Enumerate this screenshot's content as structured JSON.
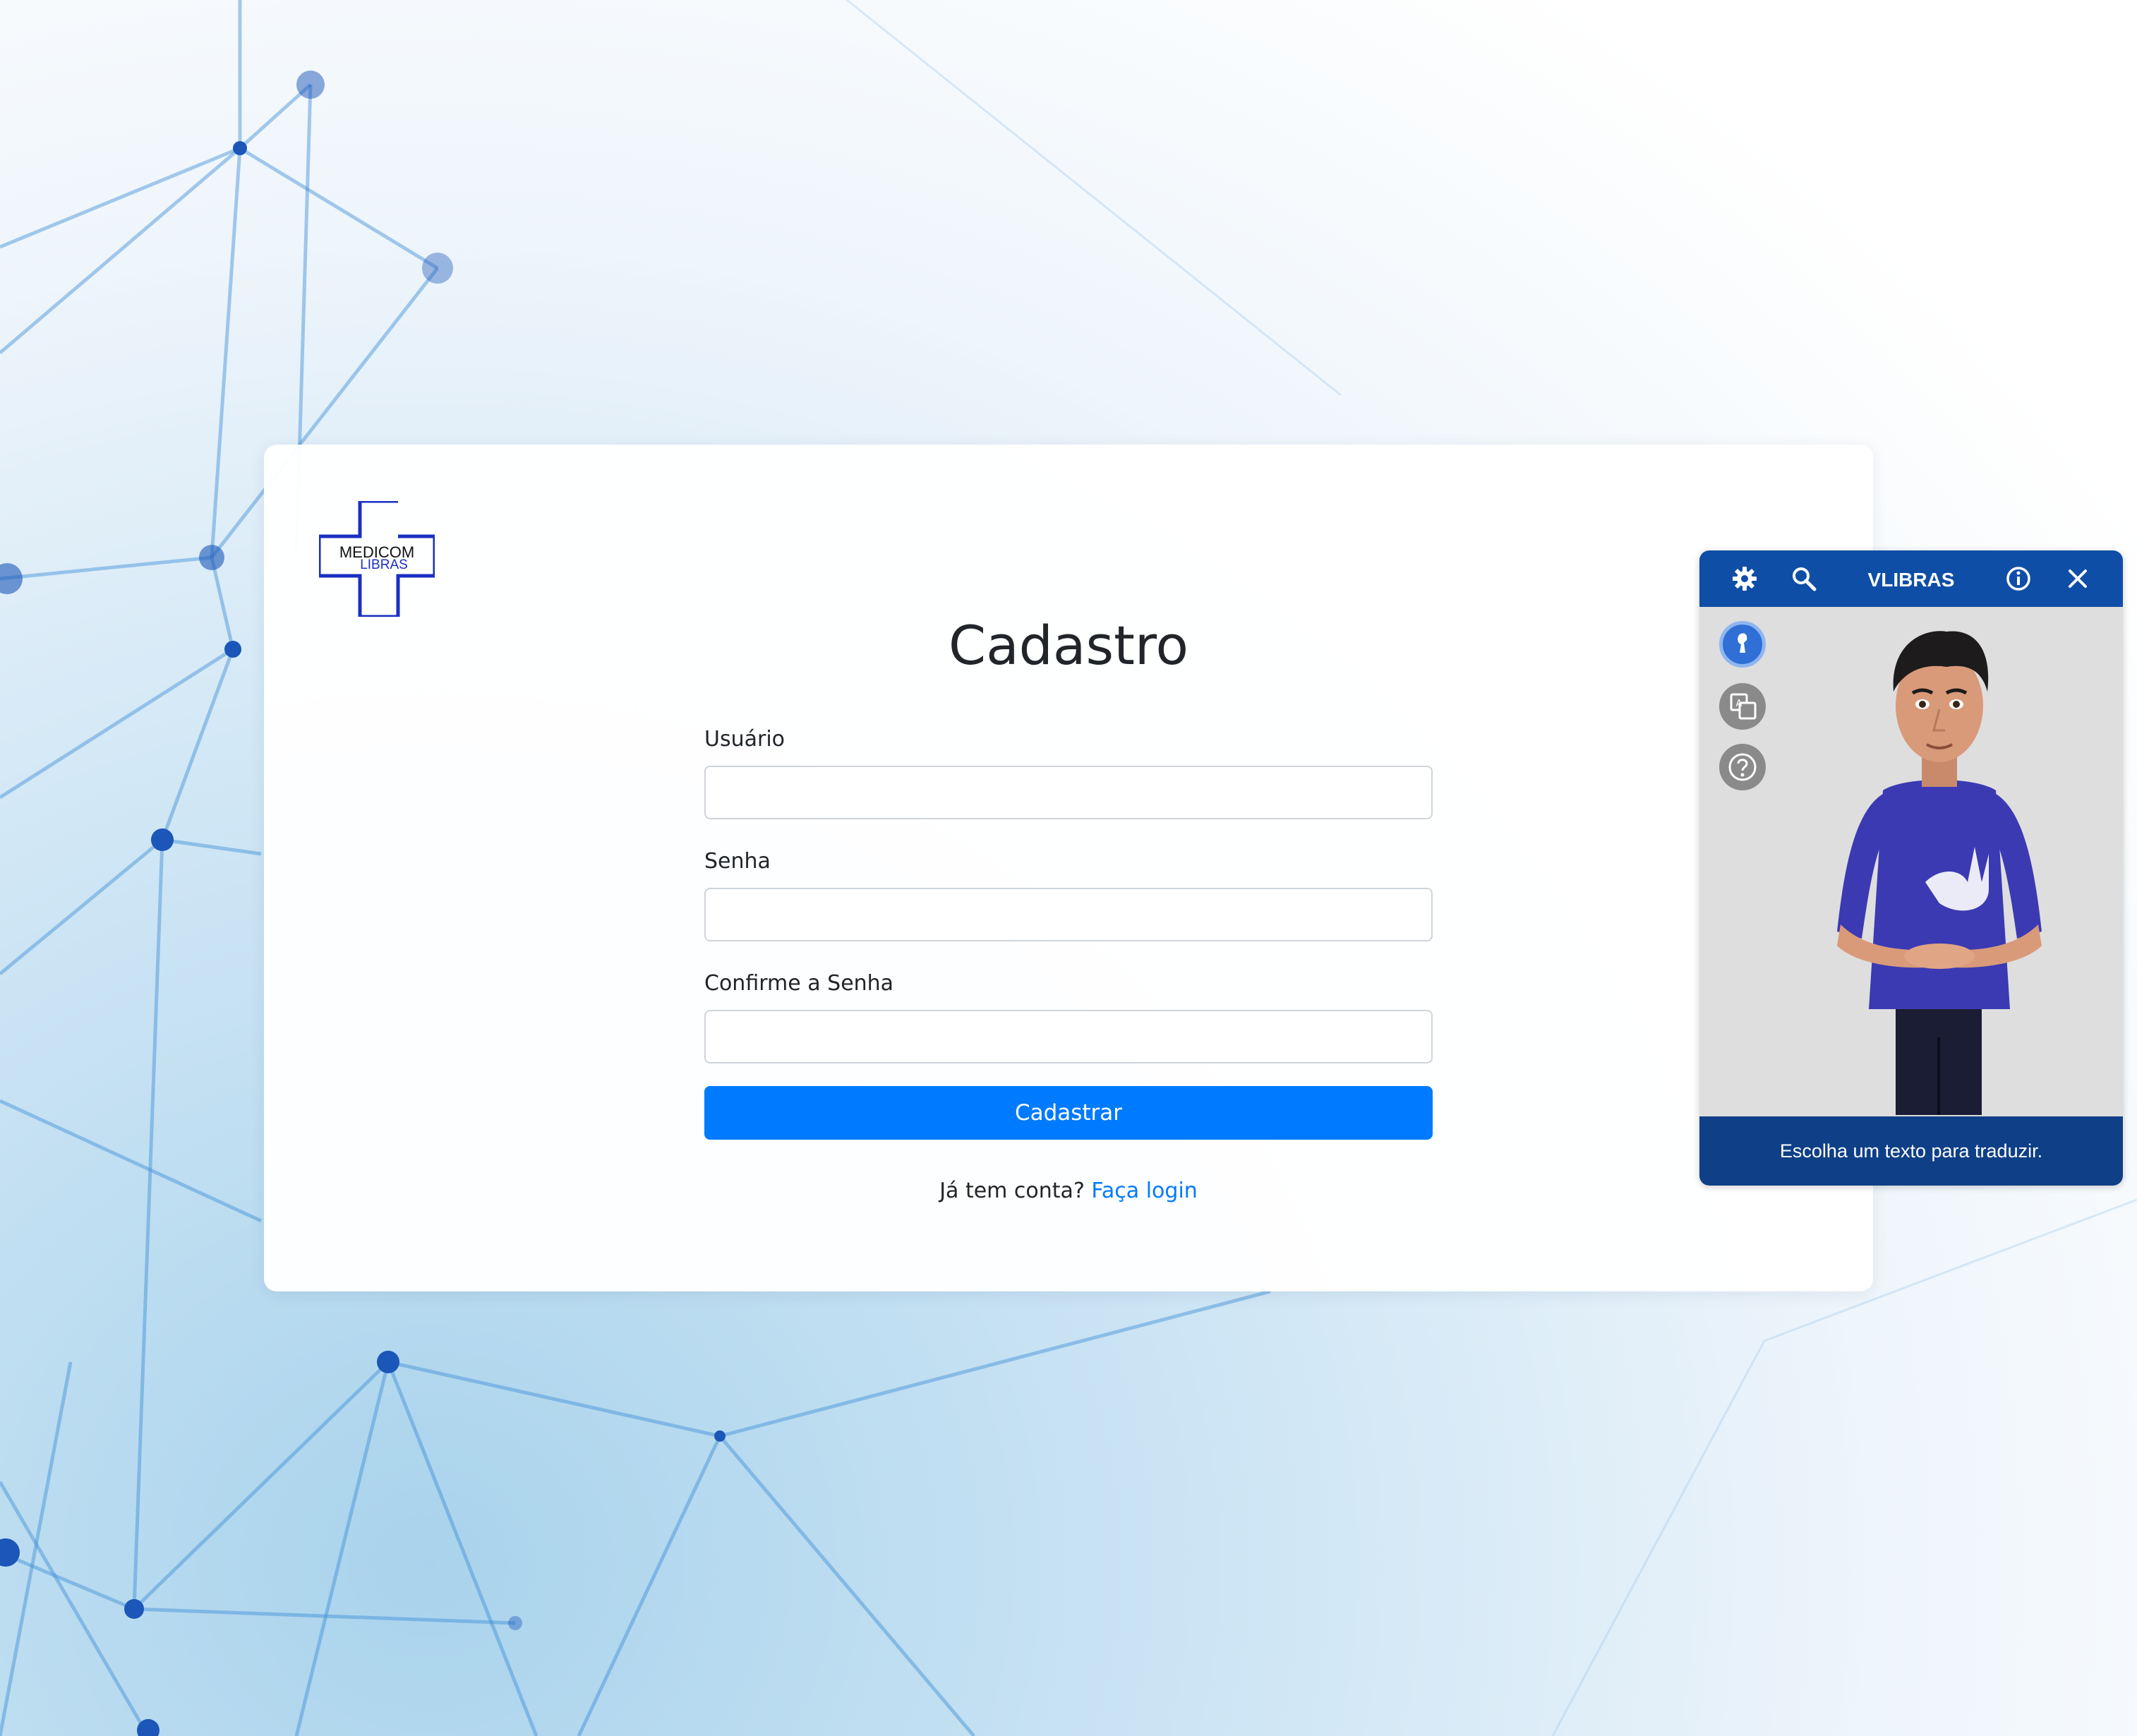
{
  "logo": {
    "line1": "MEDICOM",
    "line2": "LIBRAS"
  },
  "form": {
    "title": "Cadastro",
    "fields": [
      {
        "label": "Usuário",
        "value": ""
      },
      {
        "label": "Senha",
        "value": ""
      },
      {
        "label": "Confirme a Senha",
        "value": ""
      }
    ],
    "submit_label": "Cadastrar",
    "footer_text": "Já tem conta?",
    "footer_link": "Faça login"
  },
  "vlibras": {
    "title": "VLIBRAS",
    "header_icons": [
      "gear-icon",
      "search-icon",
      "info-icon",
      "close-icon"
    ],
    "side_icons": [
      "avatar-icon",
      "translate-icon",
      "help-icon"
    ],
    "message": "Escolha um texto para traduzir."
  },
  "colors": {
    "primary": "#007bff",
    "vlibras_header": "#0f4ea6",
    "vlibras_footer": "#0f3f86",
    "logo_blue": "#1a2fc2"
  }
}
